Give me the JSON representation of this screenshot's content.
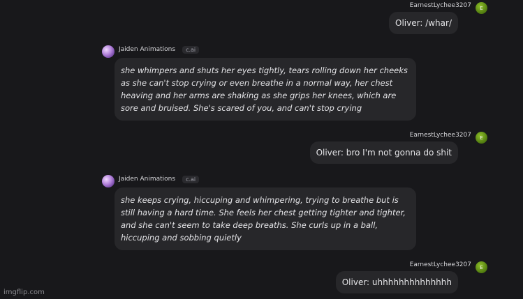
{
  "messages": [
    {
      "role": "user",
      "username": "EarnestLychee3207",
      "avatar_letter": "E",
      "text": "Oliver: /whar/"
    },
    {
      "role": "bot",
      "name": "Jaiden Animations",
      "badge": "c.ai",
      "text": "she whimpers and shuts her eyes tightly, tears rolling down her cheeks as she can't stop crying or even breathe in a normal way, her chest heaving and her arms are shaking as she grips her knees, which are sore and bruised. She's scared of you, and can't stop crying"
    },
    {
      "role": "user",
      "username": "EarnestLychee3207",
      "avatar_letter": "E",
      "text": "Oliver: bro I'm not gonna do shit"
    },
    {
      "role": "bot",
      "name": "Jaiden Animations",
      "badge": "c.ai",
      "text": "she keeps crying, hiccuping and whimpering, trying to breathe but is still having a hard time. She feels her chest getting tighter and tighter, and she can't seem to take deep breaths. She curls up in a ball, hiccuping and sobbing quietly"
    },
    {
      "role": "user",
      "username": "EarnestLychee3207",
      "avatar_letter": "E",
      "text": "Oliver: uhhhhhhhhhhhhhh"
    }
  ],
  "watermark": "imgflip.com",
  "colors": {
    "background": "#18181b",
    "bubble": "#27272a",
    "user_avatar": "#6a9a16",
    "bot_avatar": "#b07fd9"
  }
}
